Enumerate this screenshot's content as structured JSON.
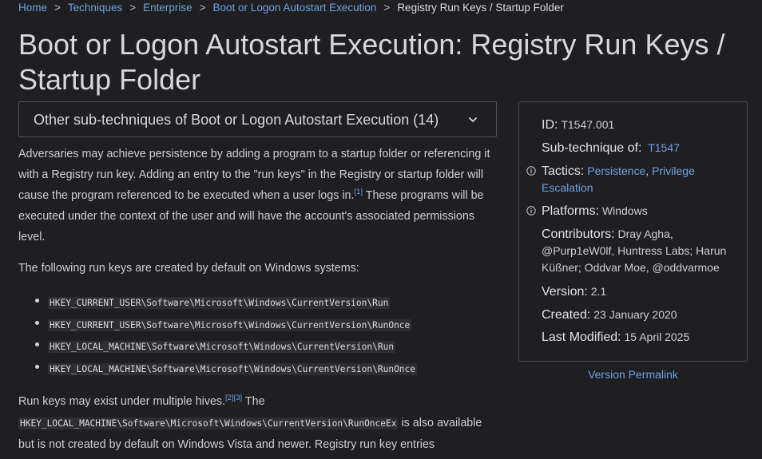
{
  "breadcrumb": {
    "items": [
      "Home",
      "Techniques",
      "Enterprise",
      "Boot or Logon Autostart Execution"
    ],
    "separator": ">",
    "current": "Registry Run Keys / Startup Folder"
  },
  "title": "Boot or Logon Autostart Execution: Registry Run Keys / Startup Folder",
  "subtechniques_dropdown": {
    "label": "Other sub-techniques of Boot or Logon Autostart Execution (14)",
    "icon": "chevron-down-icon"
  },
  "description": {
    "p1_a": "Adversaries may achieve persistence by adding a program to a startup folder or referencing it with a Registry run key. Adding an entry to the \"run keys\" in the Registry or startup folder will cause the program referenced to be executed when a user logs in.",
    "p1_ref": "[1]",
    "p1_b": " These programs will be executed under the context of the user and will have the account's associated permissions level.",
    "p2": "The following run keys are created by default on Windows systems:",
    "run_keys": [
      "HKEY_CURRENT_USER\\Software\\Microsoft\\Windows\\CurrentVersion\\Run",
      "HKEY_CURRENT_USER\\Software\\Microsoft\\Windows\\CurrentVersion\\RunOnce",
      "HKEY_LOCAL_MACHINE\\Software\\Microsoft\\Windows\\CurrentVersion\\Run",
      "HKEY_LOCAL_MACHINE\\Software\\Microsoft\\Windows\\CurrentVersion\\RunOnce"
    ],
    "p3_a": "Run keys may exist under multiple hives.",
    "p3_ref1": "[2]",
    "p3_ref2": "[3]",
    "p3_b": " The",
    "p3_code": "HKEY_LOCAL_MACHINE\\Software\\Microsoft\\Windows\\CurrentVersion\\RunOnceEx",
    "p3_c": " is also available but is not created by default on Windows Vista and newer. Registry run key entries"
  },
  "info": {
    "id_label": "ID:",
    "id_value": "T1547.001",
    "subtechnique_label": "Sub-technique of:",
    "subtechnique_value": "T1547",
    "tactics_label": "Tactics:",
    "tactics": [
      "Persistence",
      "Privilege Escalation"
    ],
    "tactics_sep": ",",
    "platforms_label": "Platforms:",
    "platforms_value": "Windows",
    "contributors_label": "Contributors:",
    "contributors_value": "Dray Agha, @Purp1eW0lf, Huntress Labs; Harun Küßner; Oddvar Moe, @oddvarmoe",
    "version_label": "Version:",
    "version_value": "2.1",
    "created_label": "Created:",
    "created_value": "23 January 2020",
    "modified_label": "Last Modified:",
    "modified_value": "15 April 2025",
    "info_icon": "info-circle-icon"
  },
  "permalink": "Version Permalink",
  "colors": {
    "background": "#1f1e21",
    "link": "#6fa1e0",
    "text": "#d0ced3",
    "code_bg": "#2e2d31"
  }
}
